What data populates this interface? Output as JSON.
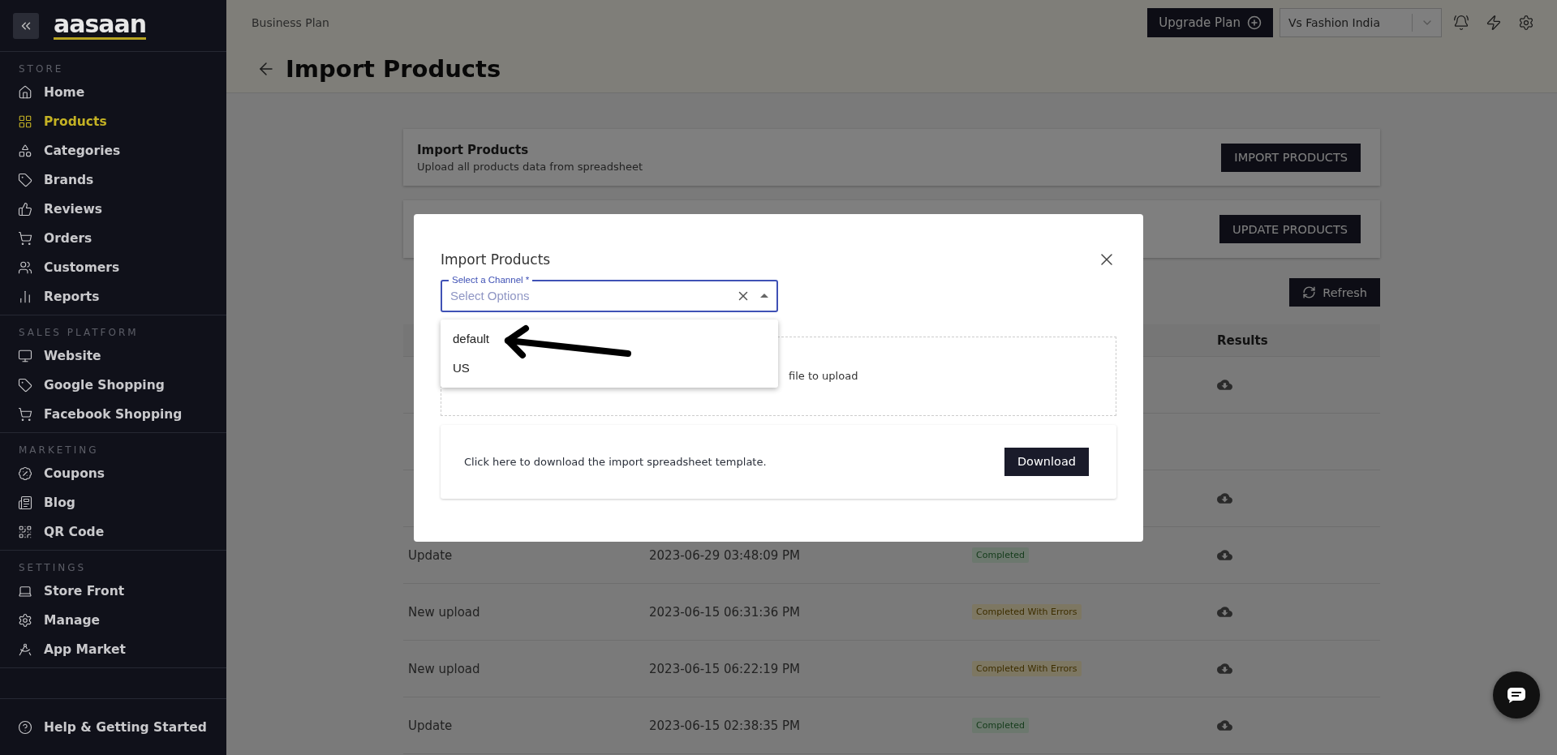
{
  "sidebar": {
    "logo": "aasaan",
    "sections": [
      {
        "title": "STORE",
        "items": [
          {
            "label": "Home",
            "selected": false
          },
          {
            "label": "Products",
            "selected": true
          },
          {
            "label": "Categories",
            "selected": false
          },
          {
            "label": "Brands",
            "selected": false
          },
          {
            "label": "Reviews",
            "selected": false
          },
          {
            "label": "Orders",
            "selected": false
          },
          {
            "label": "Customers",
            "selected": false
          },
          {
            "label": "Reports",
            "selected": false
          }
        ]
      },
      {
        "title": "SALES PLATFORM",
        "items": [
          {
            "label": "Website",
            "selected": false
          },
          {
            "label": "Google Shopping",
            "selected": false
          },
          {
            "label": "Facebook Shopping",
            "selected": false
          }
        ]
      },
      {
        "title": "MARKETING",
        "items": [
          {
            "label": "Coupons",
            "selected": false
          },
          {
            "label": "Blog",
            "selected": false
          },
          {
            "label": "QR Code",
            "selected": false
          }
        ]
      },
      {
        "title": "SETTINGS",
        "items": [
          {
            "label": "Store Front",
            "selected": false
          },
          {
            "label": "Manage",
            "selected": false
          },
          {
            "label": "App Market",
            "selected": false
          }
        ]
      }
    ],
    "help": "Help & Getting Started"
  },
  "topbar": {
    "plan": "Business Plan",
    "upgrade_button": "Upgrade Plan",
    "store_select": "Vs Fashion India"
  },
  "page_title": "Import Products",
  "cards": [
    {
      "title": "Import Products",
      "subtitle": "Upload all products data from spreadsheet",
      "button": "IMPORT PRODUCTS"
    },
    {
      "button": "UPDATE PRODUCTS"
    }
  ],
  "refresh_button": "Refresh",
  "table": {
    "results_heading": "Results",
    "rows": [
      {
        "download": true
      },
      {
        "download": false
      },
      {
        "download": true
      },
      {
        "type": "Update",
        "date": "2023-06-29 03:48:09 PM",
        "status": {
          "label": "Completed",
          "kind": "success"
        },
        "download": true
      },
      {
        "type": "New upload",
        "date": "2023-06-15 06:31:36 PM",
        "status": {
          "label": "Completed With Errors",
          "kind": "warning"
        },
        "download": true
      },
      {
        "type": "New upload",
        "date": "2023-06-15 06:22:19 PM",
        "status": {
          "label": "Completed With Errors",
          "kind": "warning"
        },
        "download": true
      },
      {
        "type": "Update",
        "date": "2023-06-15 02:38:35 PM",
        "status": {
          "label": "Completed",
          "kind": "success"
        },
        "download": true
      }
    ]
  },
  "modal": {
    "title": "Import Products",
    "select": {
      "label": "Select a Channel *",
      "placeholder": "Select Options",
      "expanded": true,
      "options": [
        {
          "label": "default",
          "selected": false
        },
        {
          "label": "US",
          "selected": false
        }
      ]
    },
    "dropzone_text": "file to upload",
    "template_text": "Click here to download the import spreadsheet template.",
    "download_button": "Download"
  }
}
